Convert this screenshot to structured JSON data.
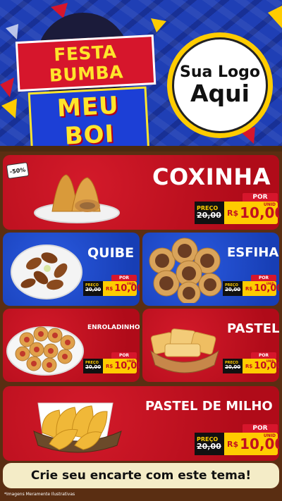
{
  "header": {
    "title_line1": "FESTA BUMBA",
    "title_line2": "MEU BOI",
    "logo_line1": "Sua Logo",
    "logo_line2": "Aqui"
  },
  "discount_badge": "-50%",
  "currency": "R$",
  "labels": {
    "preco": "PREÇO",
    "por": "POR",
    "unid": "UNID"
  },
  "products": [
    {
      "name": "COXINHA",
      "old_price": "20,00",
      "new_price": "10,00"
    },
    {
      "name": "QUIBE",
      "old_price": "20,00",
      "new_price": "10,00"
    },
    {
      "name": "ESFIHA",
      "old_price": "20,00",
      "new_price": "10,00"
    },
    {
      "name": "ENROLADINHO",
      "old_price": "20,00",
      "new_price": "10,00"
    },
    {
      "name": "PASTEL",
      "old_price": "20,00",
      "new_price": "10,00"
    },
    {
      "name": "PASTEL DE MILHO",
      "old_price": "20,00",
      "new_price": "10,00"
    }
  ],
  "footer": {
    "cta": "Crie seu encarte com este tema!"
  },
  "disclaimer": "*Imagens Meramente Ilustrativas",
  "colors": {
    "red": "#c21020",
    "blue": "#1e4bd1",
    "yellow": "#ffcc00",
    "cream": "#f4ecc7"
  }
}
